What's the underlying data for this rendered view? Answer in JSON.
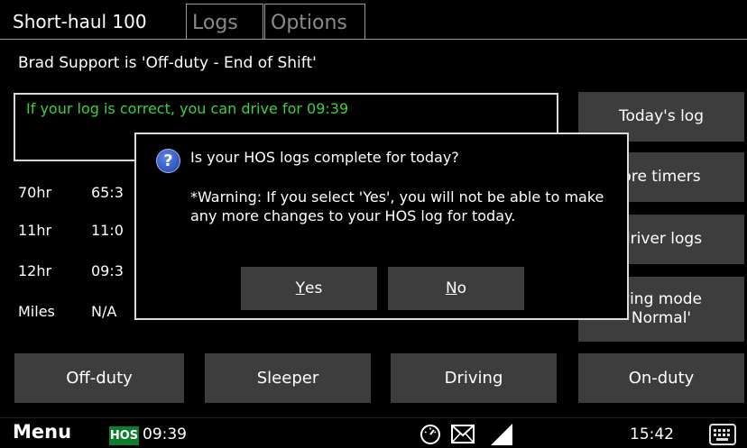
{
  "tabs": {
    "active": "Short-haul 100",
    "logs": "Logs",
    "options": "Options"
  },
  "status_line": "Brad Support is 'Off-duty - End of Shift'",
  "drive_message": "If your log is correct, you can drive for 09:39",
  "timers": [
    {
      "label": "70hr",
      "value": "65:3"
    },
    {
      "label": "11hr",
      "value": "11:0"
    },
    {
      "label": "12hr",
      "value": "09:3"
    },
    {
      "label": "Miles",
      "value": "N/A"
    }
  ],
  "right_buttons": {
    "todays_log": "Today's log",
    "more_timers": "ore timers",
    "driver_logs": "driver logs",
    "driving_mode_line1": "ving mode",
    "driving_mode_line2": "Normal'"
  },
  "duty_buttons": [
    "Off-duty",
    "Sleeper",
    "Driving",
    "On-duty"
  ],
  "dialog": {
    "question": "Is your HOS logs complete for today?",
    "warning": "*Warning: If you select 'Yes', you will not be able to make any more changes to your HOS log for today.",
    "yes_mnemonic": "Y",
    "yes_rest": "es",
    "no_mnemonic": "N",
    "no_rest": "o"
  },
  "bottom_bar": {
    "menu": "Menu",
    "hos_badge": "HOS",
    "hos_time": "09:39",
    "clock": "15:42"
  },
  "icons": [
    "question-icon",
    "gauge-icon",
    "envelope-icon",
    "signal-icon",
    "keyboard-icon"
  ],
  "colors": {
    "drive_message_green": "#3ad13a",
    "hos_badge_green": "#0e7d2f",
    "button_gray": "#3d3d3d"
  }
}
